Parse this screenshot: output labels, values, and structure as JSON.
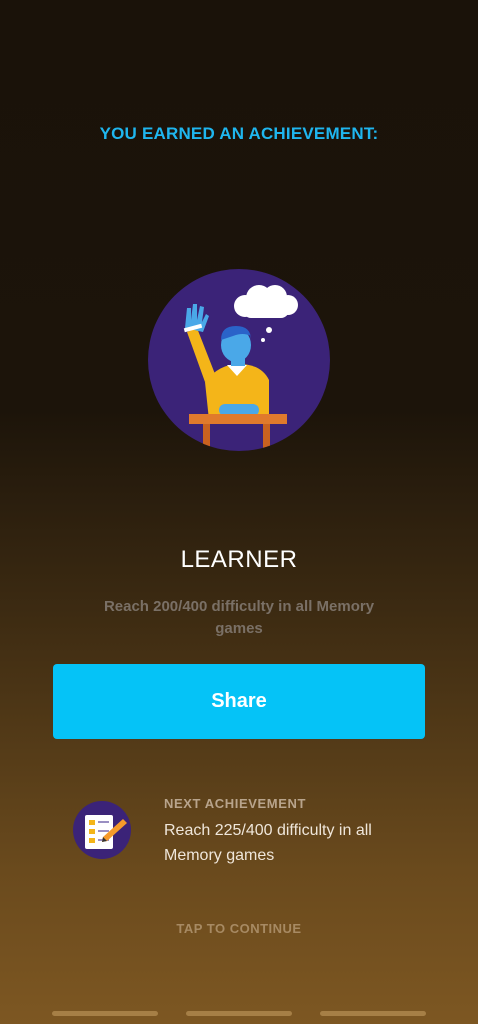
{
  "header": {
    "text": "YOU EARNED AN ACHIEVEMENT:"
  },
  "achievement": {
    "title": "LEARNER",
    "description": "Reach 200/400 difficulty in all Memory games",
    "icon": "student-raising-hand-icon"
  },
  "share": {
    "label": "Share"
  },
  "next": {
    "label": "NEXT ACHIEVEMENT",
    "description": "Reach 225/400 difficulty in all Memory games",
    "icon": "checklist-pencil-icon"
  },
  "footer": {
    "tap_label": "TAP TO CONTINUE"
  },
  "colors": {
    "accent": "#1fb6ef",
    "button": "#05c3f7",
    "badge_bg": "#3b2378"
  }
}
